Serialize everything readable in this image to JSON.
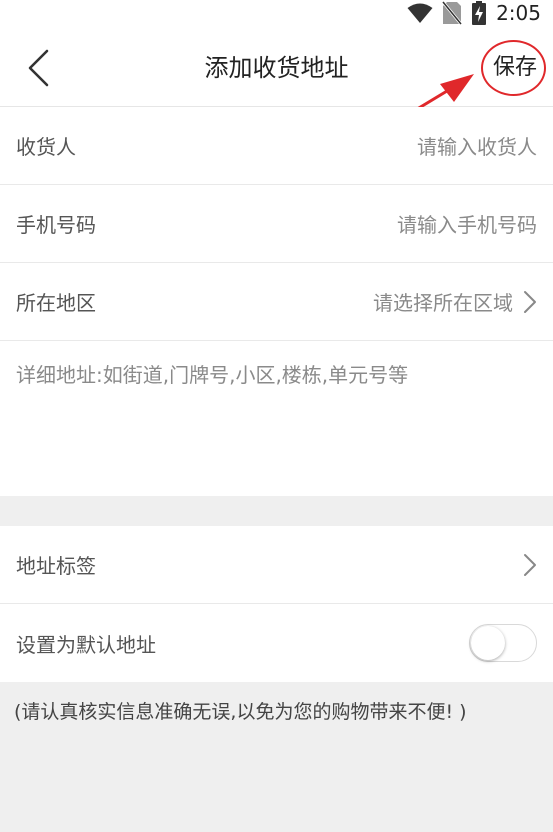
{
  "status_bar": {
    "time": "2:05",
    "icons": [
      "wifi-icon",
      "no-sim-icon",
      "battery-charging-icon"
    ]
  },
  "header": {
    "back_icon": "chevron-left-icon",
    "title": "添加收货地址",
    "save_label": "保存"
  },
  "annotation": {
    "color": "#e0282b",
    "shapes": [
      "circle",
      "arrow"
    ]
  },
  "form": {
    "receiver": {
      "label": "收货人",
      "placeholder": "请输入收货人"
    },
    "phone": {
      "label": "手机号码",
      "placeholder": "请输入手机号码"
    },
    "region": {
      "label": "所在地区",
      "placeholder": "请选择所在区域"
    },
    "address": {
      "placeholder": "详细地址:如街道,门牌号,小区,楼栋,单元号等"
    }
  },
  "options": {
    "tag": {
      "label": "地址标签"
    },
    "default": {
      "label": "设置为默认地址",
      "enabled": false
    }
  },
  "notice": "(请认真核实信息准确无误,以免为您的购物带来不便! )"
}
